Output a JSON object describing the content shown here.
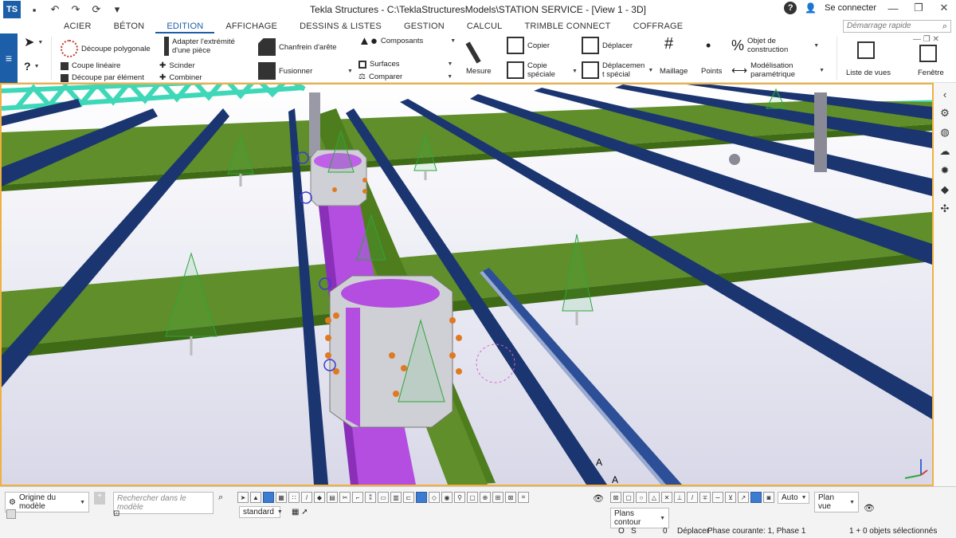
{
  "window": {
    "title": "Tekla Structures - C:\\TeklaStructuresModels\\STATION SERVICE  - [View 1 - 3D]",
    "login": "Se connecter",
    "help": "?"
  },
  "tabs": [
    "ACIER",
    "BÉTON",
    "EDITION",
    "AFFICHAGE",
    "DESSINS & LISTES",
    "GESTION",
    "CALCUL",
    "TRIMBLE CONNECT",
    "COFFRAGE"
  ],
  "active_tab": "EDITION",
  "quick_search": {
    "placeholder": "Démarrage rapide"
  },
  "ribbon": {
    "decoupe_polygonale": "Découpe polygonale",
    "adapter_extremite_1": "Adapter l'extrémité",
    "adapter_extremite_2": "d'une pièce",
    "chanfrein": "Chanfrein d'arête",
    "composants": "Composants",
    "copier": "Copier",
    "deplacer": "Déplacer",
    "objet_construction_1": "Objet de",
    "objet_construction_2": "construction",
    "coupe_lineaire": "Coupe linéaire",
    "decoupe_element": "Découpe par élément",
    "scinder": "Scinder",
    "combiner": "Combiner",
    "fusionner": "Fusionner",
    "surfaces": "Surfaces",
    "comparer": "Comparer",
    "mesure": "Mesure",
    "copie_speciale_1": "Copie",
    "copie_speciale_2": "spéciale",
    "deplacement_special_1": "Déplacemen",
    "deplacement_special_2": "t spécial",
    "maillage": "Maillage",
    "points": "Points",
    "modelisation_1": "Modélisation",
    "modelisation_2": "paramétrique",
    "liste_vues": "Liste de vues",
    "fenetre": "Fenêtre"
  },
  "viewport": {
    "labels": [
      "A",
      "A"
    ]
  },
  "statusbar": {
    "origine": "Origine du modèle",
    "search_placeholder": "Rechercher dans le modèle",
    "standard": "standard",
    "auto": "Auto",
    "plan_vue": "Plan vue",
    "plans_contour": "Plans contour",
    "o_label": "O",
    "s_label": "S",
    "zero": "0",
    "deplacer_status": "Déplacer",
    "phase": "Phase courante: 1, Phase 1",
    "selection": "1 + 0 objets sélectionnés"
  },
  "colors": {
    "accent": "#1c5fa8",
    "beam_blue": "#1b3570",
    "beam_green": "#5f8e2a",
    "column_purple": "#b44ee0",
    "truss_teal": "#3ed8b8",
    "viewport_border": "#f0b040"
  }
}
